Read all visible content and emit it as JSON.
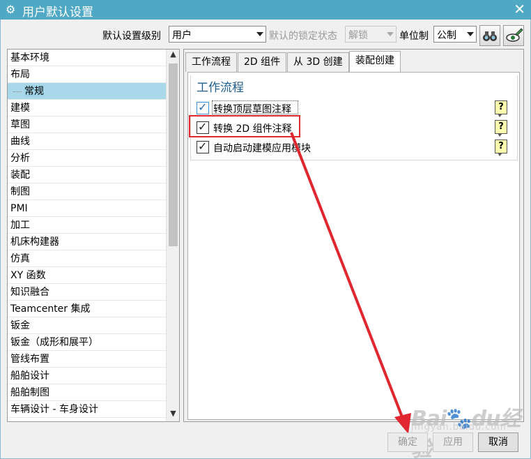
{
  "window": {
    "title": "用户默认设置"
  },
  "toolbar": {
    "level_label": "默认设置级别",
    "level_value": "用户",
    "lock_label": "默认的锁定状态",
    "lock_value": "解锁",
    "units_label": "单位制",
    "units_value": "公制"
  },
  "sidebar": {
    "items": [
      {
        "label": "基本环境"
      },
      {
        "label": "布局"
      },
      {
        "label": "常规",
        "selected": true,
        "child": true
      },
      {
        "label": "建模"
      },
      {
        "label": "草图"
      },
      {
        "label": "曲线"
      },
      {
        "label": "分析"
      },
      {
        "label": "装配"
      },
      {
        "label": "制图"
      },
      {
        "label": "PMI"
      },
      {
        "label": "加工"
      },
      {
        "label": "机床构建器"
      },
      {
        "label": "仿真"
      },
      {
        "label": "XY 函数"
      },
      {
        "label": "知识融合"
      },
      {
        "label": "Teamcenter 集成"
      },
      {
        "label": "钣金"
      },
      {
        "label": "钣金（成形和展平）"
      },
      {
        "label": "管线布置"
      },
      {
        "label": "船舶设计"
      },
      {
        "label": "船舶制图"
      },
      {
        "label": "车辆设计 - 车身设计"
      }
    ]
  },
  "tabs": [
    {
      "label": "工作流程"
    },
    {
      "label": "2D 组件"
    },
    {
      "label": "从 3D 创建"
    },
    {
      "label": "装配创建",
      "active": true
    }
  ],
  "group": {
    "title": "工作流程",
    "options": [
      {
        "label": "转换顶层草图注释",
        "checked": true,
        "help": "?"
      },
      {
        "label": "转换 2D 组件注释",
        "checked": true,
        "help": "?"
      },
      {
        "label": "自动启动建模应用模块",
        "checked": true,
        "help": "?"
      }
    ]
  },
  "buttons": {
    "ok": "确定",
    "apply": "应用",
    "cancel": "取消"
  },
  "watermark": {
    "brand": "Bai",
    "paw": "🐾",
    "brand2": "du",
    "cn": "经验",
    "sub": "jingyan.baidu.com"
  },
  "colors": {
    "titlebar": "#4fa8c4",
    "selection": "#a8d8ea",
    "annotation": "#e0262f",
    "group_title": "#1e5e8e"
  }
}
